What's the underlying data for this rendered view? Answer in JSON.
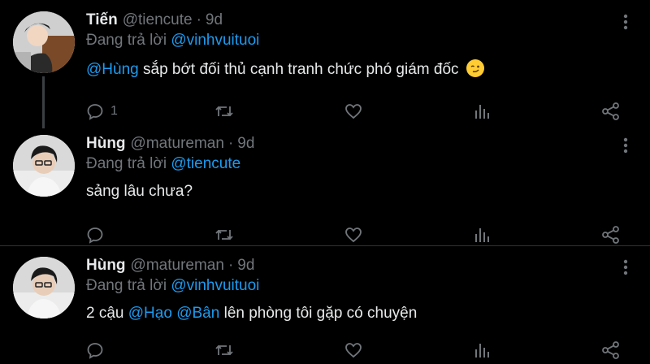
{
  "tweets": [
    {
      "name": "Tiến",
      "handle": "@tiencute",
      "dot": "·",
      "time": "9d",
      "reply_prefix": "Đang trả lời",
      "reply_to": "@vinhvuituoi",
      "text_parts": [
        {
          "type": "mention",
          "value": "@Hùng"
        },
        {
          "type": "text",
          "value": " sắp bớt đối thủ cạnh tranh chức phó giám đốc "
        }
      ],
      "emoji": "smirk-emoji",
      "reply_count": "1"
    },
    {
      "name": "Hùng",
      "handle": "@matureman",
      "dot": "·",
      "time": "9d",
      "reply_prefix": "Đang trả lời",
      "reply_to": "@tiencute",
      "text_parts": [
        {
          "type": "text",
          "value": "sảng lâu chưa?"
        }
      ],
      "reply_count": ""
    },
    {
      "name": "Hùng",
      "handle": "@matureman",
      "dot": "·",
      "time": "9d",
      "reply_prefix": "Đang trả lời",
      "reply_to": "@vinhvuituoi",
      "text_parts": [
        {
          "type": "text",
          "value": "2 cậu "
        },
        {
          "type": "mention",
          "value": "@Hạo"
        },
        {
          "type": "text",
          "value": " "
        },
        {
          "type": "mention",
          "value": "@Bân"
        },
        {
          "type": "text",
          "value": " lên phòng tôi gặp có chuyện"
        }
      ],
      "reply_count": ""
    }
  ],
  "colors": {
    "background": "#000000",
    "text": "#e7e9ea",
    "muted": "#71767b",
    "accent": "#1d9bf0",
    "divider": "#2f3336"
  },
  "icons": [
    "reply-icon",
    "retweet-icon",
    "like-icon",
    "views-icon",
    "share-icon",
    "more-icon"
  ]
}
